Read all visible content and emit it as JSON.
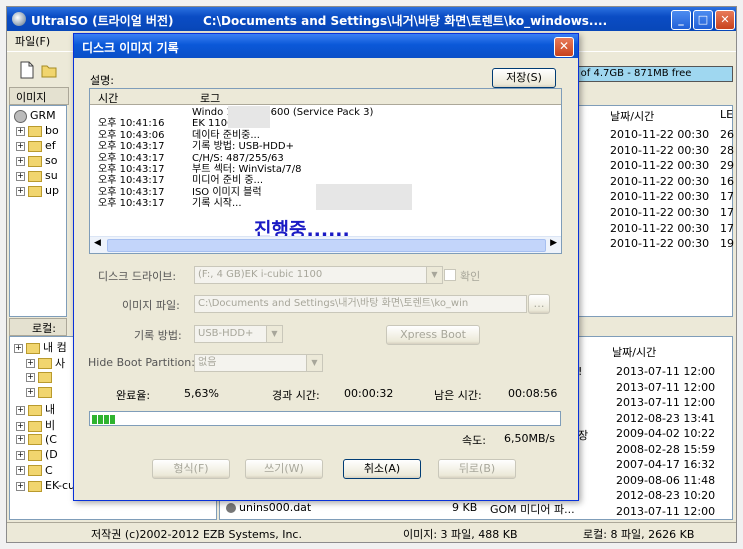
{
  "main_window": {
    "title": "UltraISO (트라이얼 버전)",
    "title_path": "C:\\Documents and Settings\\내거\\바탕 화면\\토렌트\\ko_windows....",
    "menu_file": "파일(F)",
    "size_info": "% of 4.7GB - 871MB free",
    "top_pane_label": "이미지",
    "bottom_pane_label": "로컬:",
    "top_tree": [
      {
        "label": "GRM"
      },
      {
        "label": "bo"
      },
      {
        "label": "ef"
      },
      {
        "label": "so"
      },
      {
        "label": "su"
      },
      {
        "label": "up"
      }
    ],
    "top_columns": {
      "date": "날짜/시간",
      "extra": "LE"
    },
    "top_rows": [
      {
        "date": "2010-11-22 00:30",
        "extra": "26"
      },
      {
        "date": "2010-11-22 00:30",
        "extra": "28"
      },
      {
        "date": "2010-11-22 00:30",
        "extra": "29"
      },
      {
        "date": "2010-11-22 00:30",
        "extra": "16"
      },
      {
        "date": "2010-11-22 00:30",
        "extra": "17"
      },
      {
        "date": "2010-11-22 00:30",
        "extra": "17"
      },
      {
        "date": "2010-11-22 00:30",
        "extra": "17"
      },
      {
        "date": "2010-11-22 00:30",
        "extra": "19"
      }
    ],
    "bottom_tree": [
      {
        "label": "내 컴"
      },
      {
        "label": "사"
      },
      {
        "label": ""
      },
      {
        "label": ""
      },
      {
        "label": "내"
      },
      {
        "label": "비"
      },
      {
        "label": "(C"
      },
      {
        "label": "(D"
      },
      {
        "label": "C"
      },
      {
        "label": "EK-cubic(F:)"
      }
    ],
    "bottom_columns": {
      "date": "날짜/시간"
    },
    "bottom_rows": [
      {
        "mark": "!",
        "date": "2013-07-11 12:00"
      },
      {
        "mark": "",
        "date": "2013-07-11 12:00"
      },
      {
        "mark": "",
        "date": "2013-07-11 12:00"
      },
      {
        "mark": "",
        "date": "2012-08-23 13:41"
      },
      {
        "mark": "장",
        "date": "2009-04-02 10:22"
      },
      {
        "mark": "",
        "date": "2008-02-28 15:59"
      },
      {
        "mark": "",
        "date": "2007-04-17 16:32"
      },
      {
        "mark": "",
        "date": "2009-08-06 11:48"
      },
      {
        "mark": "",
        "date": "2012-08-23 10:20"
      },
      {
        "mark": "",
        "date": "2013-07-11 12:00"
      }
    ],
    "bottom_file": {
      "name": "unins000.dat",
      "size": "9 KB",
      "type": "GOM 미디어 파..."
    },
    "status": {
      "copyright": "저작권 (c)2002-2012 EZB Systems, Inc.",
      "image_info": "이미지: 3 파일, 488 KB",
      "local_info": "로컬: 8 파일, 2626 KB"
    }
  },
  "dialog": {
    "title": "디스크 이미지 기록",
    "desc_label": "설명:",
    "save_button": "저장(S)",
    "log_columns": {
      "time": "시간",
      "log": "로그"
    },
    "log_rows": [
      {
        "time": "",
        "msg": "Windo          1 Build 2600 (Service Pack 3)"
      },
      {
        "time": "오후 10:41:16",
        "msg": "EK                  1100"
      },
      {
        "time": "오후 10:43:06",
        "msg": "데이타 준비중..."
      },
      {
        "time": "오후 10:43:17",
        "msg": "기록 방법: USB-HDD+"
      },
      {
        "time": "오후 10:43:17",
        "msg": "C/H/S: 487/255/63"
      },
      {
        "time": "오후 10:43:17",
        "msg": "부트 섹터: WinVista/7/8"
      },
      {
        "time": "오후 10:43:17",
        "msg": "미디어 준비 중..."
      },
      {
        "time": "오후 10:43:17",
        "msg": "ISO 이미지 블럭 "
      },
      {
        "time": "오후 10:43:17",
        "msg": "기록 시작..."
      }
    ],
    "overlay_text": "진행중......",
    "disk_drive_label": "디스크 드라이브:",
    "disk_drive_value": "(F:, 4 GB)EK      i-cubic         1100",
    "confirm_label": "확인",
    "image_file_label": "이미지 파일:",
    "image_file_value": "C:\\Documents and Settings\\내거\\바탕 화면\\토렌트\\ko_win",
    "write_method_label": "기록 방법:",
    "write_method_value": "USB-HDD+",
    "xpress_boot_button": "Xpress Boot",
    "hide_boot_label": "Hide Boot Partition:",
    "hide_boot_value": "없음",
    "complete_label": "완료율:",
    "complete_value": "5,63%",
    "elapsed_label": "경과 시간:",
    "elapsed_value": "00:00:32",
    "remaining_label": "남은 시간:",
    "remaining_value": "00:08:56",
    "progress_fraction": 0.0563,
    "speed_label": "속도:",
    "speed_value": "6,50MB/s",
    "format_button": "형식(F)",
    "write_button": "쓰기(W)",
    "cancel_button": "취소(A)",
    "back_button": "뒤로(B)"
  }
}
